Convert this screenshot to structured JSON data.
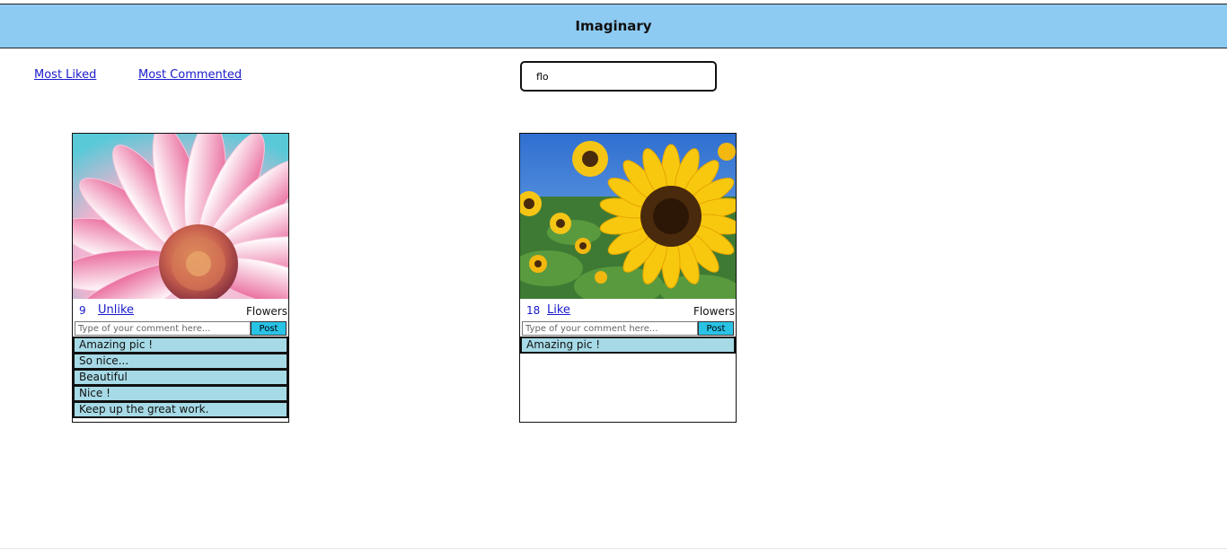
{
  "app": {
    "title": "Imaginary"
  },
  "nav": {
    "most_liked": "Most Liked",
    "most_commented": "Most Commented"
  },
  "search": {
    "value": "flo"
  },
  "colors": {
    "header_bg": "#8ecbf2",
    "comment_bg": "#a6dae6",
    "post_button": "#29c3e6",
    "link": "#1a1acc"
  },
  "posts": [
    {
      "image_icon": "pink-daisy-photo",
      "likes": "9",
      "like_action": "Unlike",
      "category": "Flowers",
      "comment_placeholder": "Type of your comment here...",
      "post_label": "Post",
      "comments": [
        "Amazing pic !",
        "So nice...",
        "Beautiful",
        "Nice !",
        "Keep up the great work."
      ]
    },
    {
      "image_icon": "sunflower-photo",
      "likes": "18",
      "like_action": "Like",
      "category": "Flowers",
      "comment_placeholder": "Type of your comment here...",
      "post_label": "Post",
      "comments": [
        "Amazing pic !"
      ]
    }
  ]
}
